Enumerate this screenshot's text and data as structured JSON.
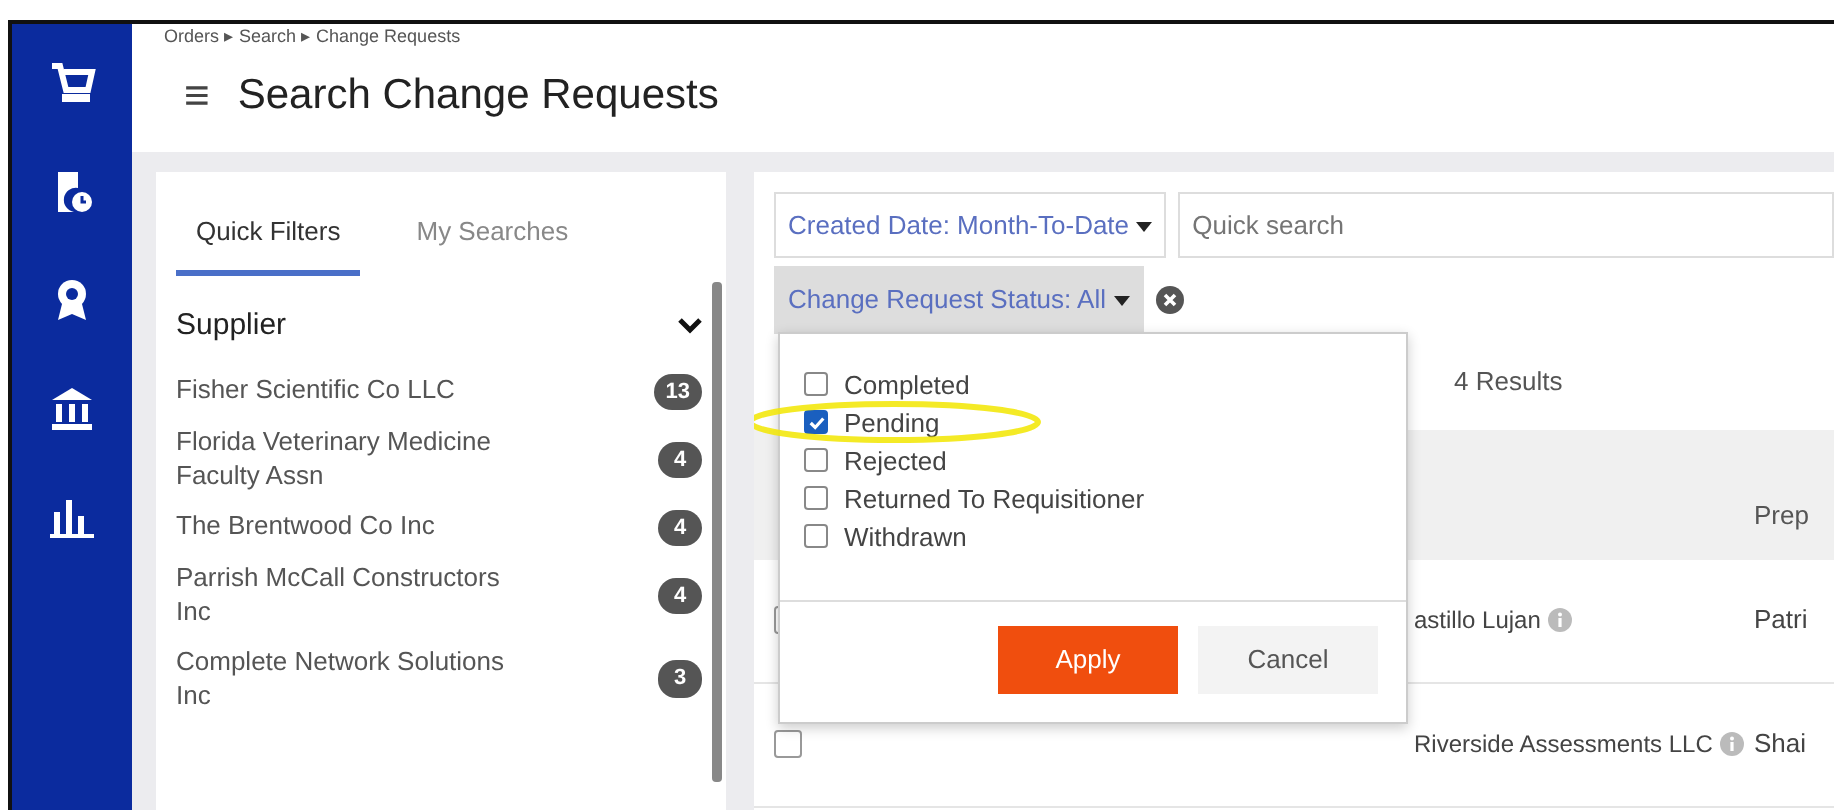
{
  "breadcrumb": "Orders ▸ Search ▸ Change Requests",
  "sidebar": {
    "items": [
      {
        "kind": "cart"
      },
      {
        "kind": "doc"
      },
      {
        "kind": "award"
      },
      {
        "kind": "bank"
      },
      {
        "kind": "chart"
      }
    ]
  },
  "header": {
    "menu": "≡",
    "title": "Search Change Requests"
  },
  "filters_panel": {
    "tabs": [
      {
        "label": "Quick Filters",
        "selected": true
      },
      {
        "label": "My Searches",
        "selected": false
      }
    ],
    "section": {
      "title": "Supplier",
      "expanded": true,
      "items": [
        {
          "name": "Fisher Scientific Co LLC",
          "count": "13"
        },
        {
          "name": "Florida Veterinary Medicine Faculty Assn",
          "count": "4"
        },
        {
          "name": "The Brentwood Co Inc",
          "count": "4"
        },
        {
          "name": "Parrish McCall Constructors Inc",
          "count": "4"
        },
        {
          "name": "Complete Network Solutions Inc",
          "count": "3"
        }
      ]
    }
  },
  "search": {
    "date_filter": "Created Date: Month-To-Date",
    "placeholder": "Quick search",
    "status_filter": "Change Request Status: All"
  },
  "status_dropdown": {
    "options": [
      {
        "label": "Completed",
        "checked": false
      },
      {
        "label": "Pending",
        "checked": true
      },
      {
        "label": "Rejected",
        "checked": false
      },
      {
        "label": "Returned To Requisitioner",
        "checked": false
      },
      {
        "label": "Withdrawn",
        "checked": false
      }
    ],
    "buttons": [
      {
        "label": "Apply",
        "kind": "primary"
      },
      {
        "label": "Cancel",
        "kind": "secondary"
      }
    ]
  },
  "results": {
    "count": "4 Results"
  },
  "table": {
    "columns": [
      "Prep"
    ],
    "rows": [
      {
        "checked": false,
        "supplier": "astillo Lujan",
        "preparer": "Patri"
      },
      {
        "checked": false,
        "supplier": "Riverside Assessments LLC",
        "preparer": "Shai"
      }
    ]
  }
}
